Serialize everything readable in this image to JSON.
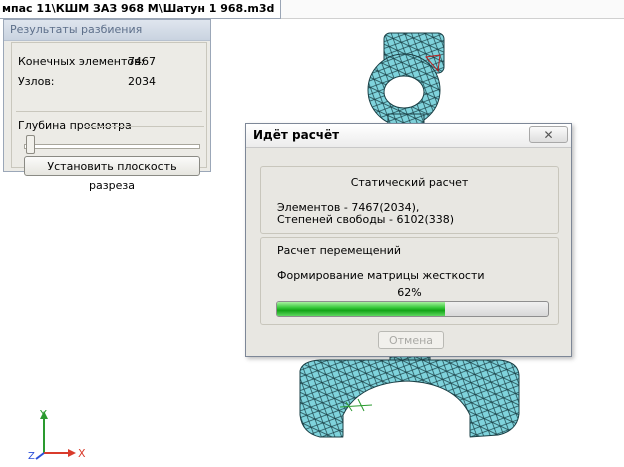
{
  "window": {
    "title": "мпас 11\\КШМ ЗАЗ 968 М\\Шатун 1 968.m3d"
  },
  "results_panel": {
    "title": "Результаты разбиения",
    "final_elements_label": "Конечных элементов:",
    "final_elements_value": "7467",
    "nodes_label": "Узлов:",
    "nodes_value": "2034",
    "depth_label": "Глубина просмотра",
    "set_plane_button": "Установить плоскость разреза"
  },
  "calc_dialog": {
    "title": "Идёт расчёт",
    "close_label": "✕",
    "heading": "Статический расчет",
    "elements_text": "Элементов - 7467(2034),",
    "dof_text": "Степеней свободы - 6102(338)",
    "stage_label": "Расчет перемещений",
    "substage_label": "Формирование матрицы жесткости",
    "progress_text": "62%",
    "progress_value": 0.62,
    "cancel_button": "Отмена"
  },
  "axes": {
    "x": "X",
    "y": "Y",
    "z": "Z"
  },
  "colors": {
    "mesh_fill": "#7fd3dc",
    "mesh_line": "#1a3f45",
    "progress_green": "#1db321",
    "x_axis": "#d93b2b",
    "y_axis": "#2a9a2f",
    "z_axis": "#2b4fd9"
  }
}
